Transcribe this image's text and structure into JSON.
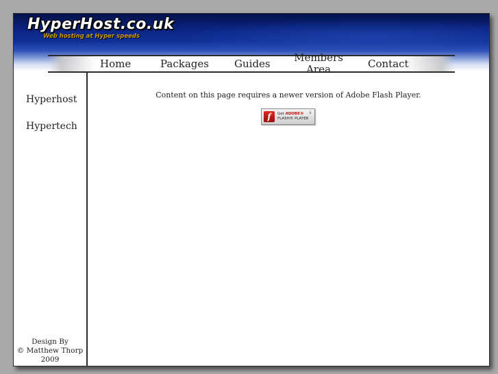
{
  "header": {
    "site_title": "HyperHost.co.uk",
    "tagline": "Web hosting at Hyper speeds"
  },
  "nav": {
    "items": [
      {
        "label": "Home"
      },
      {
        "label": "Packages"
      },
      {
        "label": "Guides"
      },
      {
        "label": "Members Area"
      },
      {
        "label": "Contact"
      }
    ]
  },
  "sidebar": {
    "links": [
      {
        "label": "Hyperhost"
      },
      {
        "label": "Hypertech"
      }
    ],
    "credit": {
      "line1": "Design By",
      "line2": "© Matthew Thorp",
      "line3": "2009"
    }
  },
  "main": {
    "message": "Content on this page requires a newer version of Adobe Flash Player.",
    "flash_badge": {
      "icon": "flash-player-icon",
      "line1_prefix": "Get",
      "line1_brand": "ADOBE®",
      "line2": "FLASH® PLAYER",
      "arrow": "↓"
    }
  },
  "colors": {
    "page_background": "#a9a9a9",
    "header_dark_blue": "#0a2380",
    "tagline_gold": "#c89a10",
    "flash_red": "#c8120c"
  }
}
